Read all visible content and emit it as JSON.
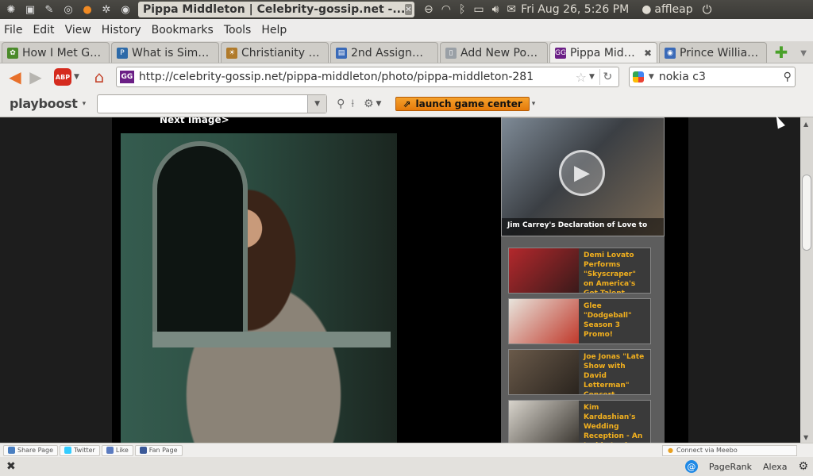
{
  "system_panel": {
    "window_title": "Pippa Middleton | Celebrity-gossip.net -...",
    "datetime": "Fri Aug 26,  5:26 PM",
    "username": "affleap"
  },
  "menu": [
    "File",
    "Edit",
    "View",
    "History",
    "Bookmarks",
    "Tools",
    "Help"
  ],
  "tabs": [
    {
      "label": "How I Met Go...",
      "color": "#4a8a2a",
      "glyph": "✿"
    },
    {
      "label": "What is Simpl...",
      "color": "#2d6aa8",
      "glyph": "P"
    },
    {
      "label": "Christianity To...",
      "color": "#b07a2a",
      "glyph": "☀"
    },
    {
      "label": "2nd Assignme...",
      "color": "#3a6ab8",
      "glyph": "▤"
    },
    {
      "label": "Add New Post ...",
      "color": "#9aa0a6",
      "glyph": "▯"
    },
    {
      "label": "Pippa Middl...",
      "color": "#6b1f86",
      "glyph": "GG",
      "active": true
    },
    {
      "label": "Prince William...",
      "color": "#3a6ab8",
      "glyph": "◉"
    }
  ],
  "nav": {
    "url": "http://celebrity-gossip.net/pippa-middleton/photo/pippa-middleton-281",
    "search_value": "nokia c3",
    "abp_label": "ABP"
  },
  "playboost": {
    "logo": "playboost",
    "launch_label": "launch game center"
  },
  "page": {
    "next_image": "Next Image>",
    "video_caption": "Jim Carrey's Declaration of Love to",
    "videos": [
      {
        "title": "Demi Lovato Performs \"Skyscraper\" on America's Got Talent",
        "thumb": "#b3282c"
      },
      {
        "title": "Glee \"Dodgeball\" Season 3 Promo!",
        "thumb": "#e8e4dc"
      },
      {
        "title": "Joe Jonas \"Late Show with David Letterman\" Concert",
        "thumb": "#6a5a4a"
      },
      {
        "title": "Kim Kardashian's Wedding Reception - An Inside Look",
        "thumb": "#7a7670"
      }
    ]
  },
  "sharebar": {
    "share": "Share Page",
    "twitter": "Twitter",
    "like": "Like",
    "fanpage": "Fan Page",
    "meebo": "Connect via Meebo"
  },
  "status": {
    "pagerank": "PageRank",
    "alexa": "Alexa"
  }
}
